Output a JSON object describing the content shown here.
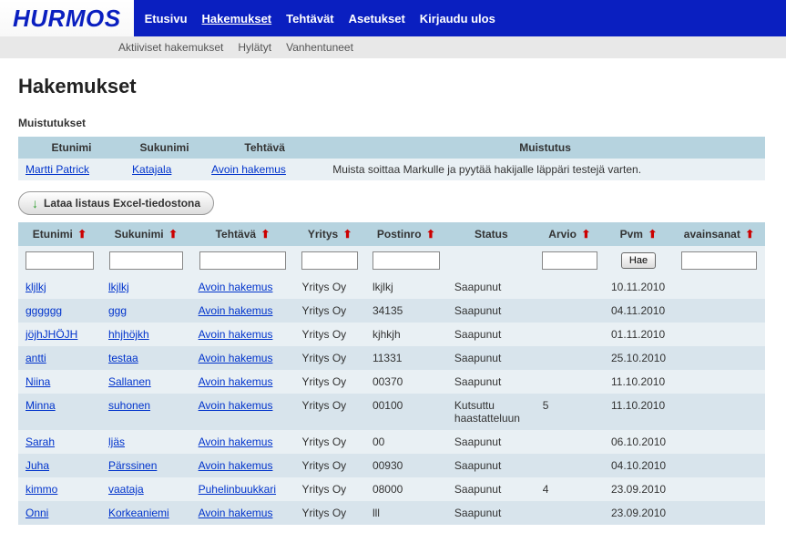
{
  "brand": "HURMOS",
  "nav": {
    "primary": [
      {
        "label": "Etusivu",
        "active": false
      },
      {
        "label": "Hakemukset",
        "active": true
      },
      {
        "label": "Tehtävät",
        "active": false
      },
      {
        "label": "Asetukset",
        "active": false
      },
      {
        "label": "Kirjaudu ulos",
        "active": false
      }
    ],
    "secondary": [
      {
        "label": "Aktiiviset hakemukset"
      },
      {
        "label": "Hylätyt"
      },
      {
        "label": "Vanhentuneet"
      }
    ]
  },
  "page_title": "Hakemukset",
  "reminders": {
    "heading": "Muistutukset",
    "columns": [
      "Etunimi",
      "Sukunimi",
      "Tehtävä",
      "Muistutus"
    ],
    "rows": [
      {
        "etunimi": "Martti Patrick",
        "sukunimi": "Katajala",
        "tehtava": "Avoin hakemus",
        "muistutus": "Muista soittaa Markulle ja pyytää hakijalle läppäri testejä varten."
      }
    ]
  },
  "download_button": "Lataa listaus Excel-tiedostona",
  "listing": {
    "columns": [
      {
        "label": "Etunimi",
        "sortable": true,
        "filter": true
      },
      {
        "label": "Sukunimi",
        "sortable": true,
        "filter": true
      },
      {
        "label": "Tehtävä",
        "sortable": true,
        "filter": true
      },
      {
        "label": "Yritys",
        "sortable": true,
        "filter": true
      },
      {
        "label": "Postinro",
        "sortable": true,
        "filter": true
      },
      {
        "label": "Status",
        "sortable": false,
        "filter": false
      },
      {
        "label": "Arvio",
        "sortable": true,
        "filter": true
      },
      {
        "label": "Pvm",
        "sortable": true,
        "filter": false,
        "button": "Hae"
      },
      {
        "label": "avainsanat",
        "sortable": true,
        "filter": true
      }
    ],
    "rows": [
      {
        "etunimi": "kljlkj",
        "sukunimi": "lkjlkj",
        "tehtava": "Avoin hakemus",
        "yritys": "Yritys Oy",
        "postinro": "lkjlkj",
        "status": "Saapunut",
        "arvio": "",
        "pvm": "10.11.2010",
        "avainsanat": ""
      },
      {
        "etunimi": "gggggg",
        "sukunimi": "ggg",
        "tehtava": "Avoin hakemus",
        "yritys": "Yritys Oy",
        "postinro": "34135",
        "status": "Saapunut",
        "arvio": "",
        "pvm": "04.11.2010",
        "avainsanat": ""
      },
      {
        "etunimi": "jöjhJHÖJH",
        "sukunimi": "hhjhöjkh",
        "tehtava": "Avoin hakemus",
        "yritys": "Yritys Oy",
        "postinro": "kjhkjh",
        "status": "Saapunut",
        "arvio": "",
        "pvm": "01.11.2010",
        "avainsanat": ""
      },
      {
        "etunimi": "antti",
        "sukunimi": "testaa",
        "tehtava": "Avoin hakemus",
        "yritys": "Yritys Oy",
        "postinro": "11331",
        "status": "Saapunut",
        "arvio": "",
        "pvm": "25.10.2010",
        "avainsanat": ""
      },
      {
        "etunimi": "Niina",
        "sukunimi": "Sallanen",
        "tehtava": "Avoin hakemus",
        "yritys": "Yritys Oy",
        "postinro": "00370",
        "status": "Saapunut",
        "arvio": "",
        "pvm": "11.10.2010",
        "avainsanat": ""
      },
      {
        "etunimi": "Minna",
        "sukunimi": "suhonen",
        "tehtava": "Avoin hakemus",
        "yritys": "Yritys Oy",
        "postinro": "00100",
        "status": "Kutsuttu haastatteluun",
        "arvio": "5",
        "pvm": "11.10.2010",
        "avainsanat": ""
      },
      {
        "etunimi": "Sarah",
        "sukunimi": "ljäs",
        "tehtava": "Avoin hakemus",
        "yritys": "Yritys Oy",
        "postinro": "00",
        "status": "Saapunut",
        "arvio": "",
        "pvm": "06.10.2010",
        "avainsanat": ""
      },
      {
        "etunimi": "Juha",
        "sukunimi": "Pärssinen",
        "tehtava": "Avoin hakemus",
        "yritys": "Yritys Oy",
        "postinro": "00930",
        "status": "Saapunut",
        "arvio": "",
        "pvm": "04.10.2010",
        "avainsanat": ""
      },
      {
        "etunimi": "kimmo",
        "sukunimi": "vaataja",
        "tehtava": "Puhelinbuukkari",
        "yritys": "Yritys Oy",
        "postinro": "08000",
        "status": "Saapunut",
        "arvio": "4",
        "pvm": "23.09.2010",
        "avainsanat": ""
      },
      {
        "etunimi": "Onni",
        "sukunimi": "Korkeaniemi",
        "tehtava": "Avoin hakemus",
        "yritys": "Yritys Oy",
        "postinro": "lll",
        "status": "Saapunut",
        "arvio": "",
        "pvm": "23.09.2010",
        "avainsanat": ""
      }
    ]
  }
}
